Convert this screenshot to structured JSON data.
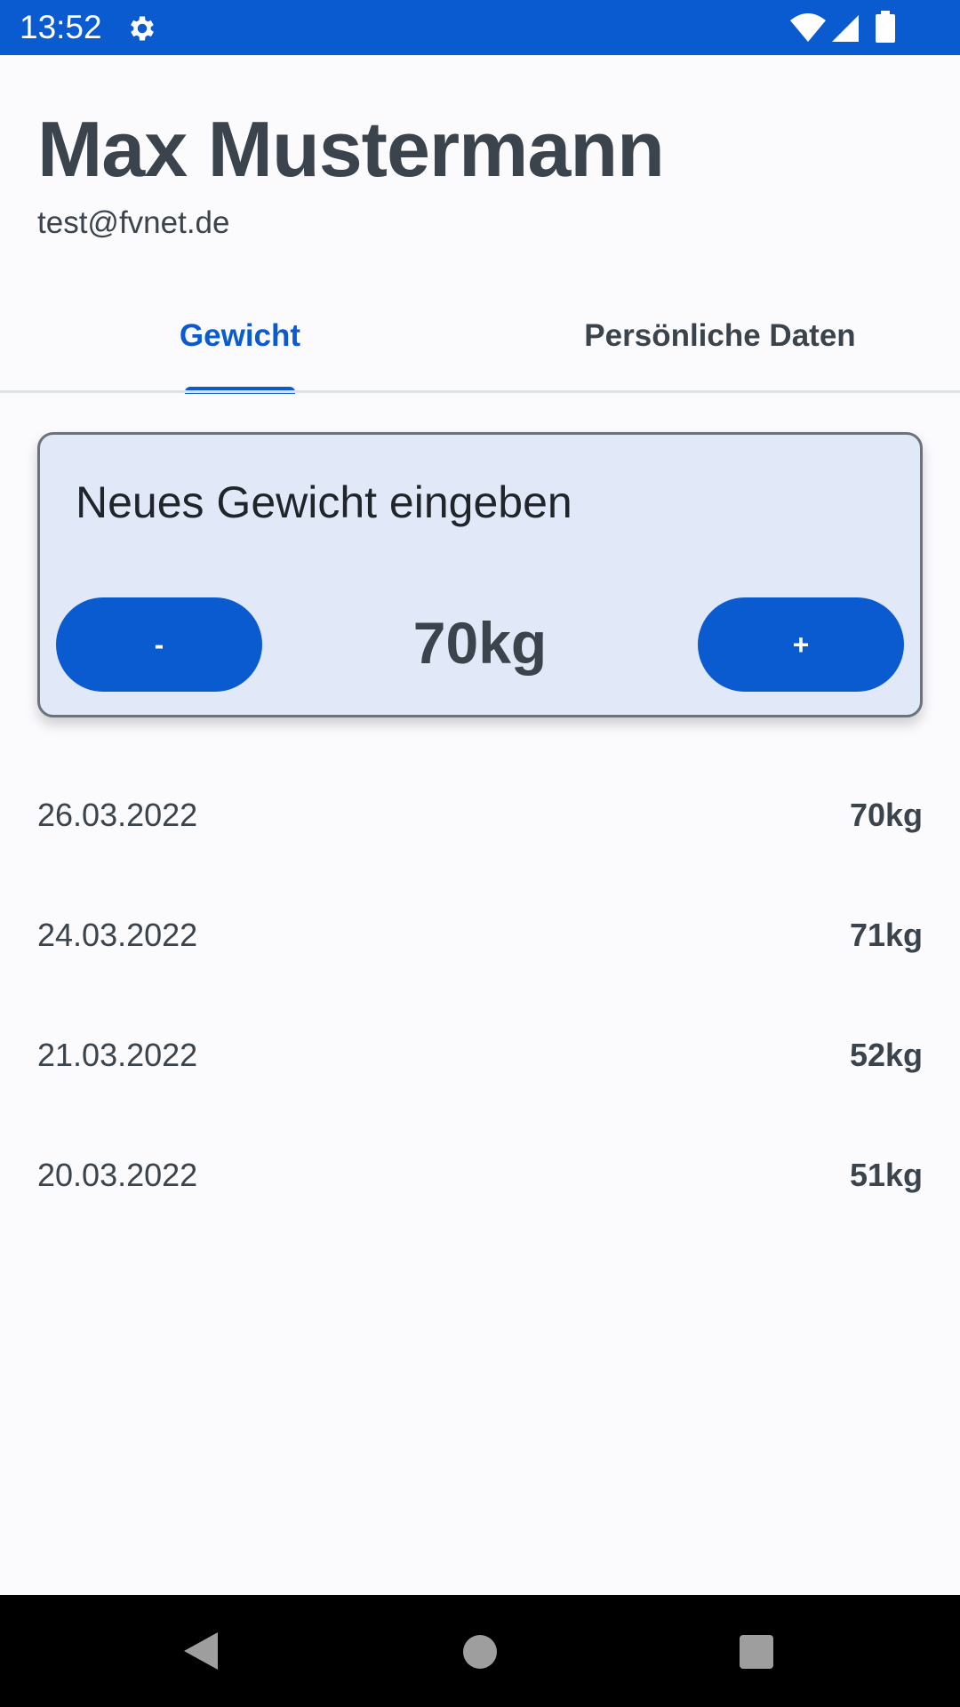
{
  "status_bar": {
    "time": "13:52",
    "icons": [
      "gear-icon",
      "wifi-icon",
      "signal-icon",
      "battery-icon"
    ],
    "color": "#0b5bd0"
  },
  "profile": {
    "name": "Max Mustermann",
    "email": "test@fvnet.de"
  },
  "tabs": [
    {
      "label": "Gewicht",
      "active": true
    },
    {
      "label": "Persönliche Daten",
      "active": false
    }
  ],
  "weight_card": {
    "title": "Neues Gewicht eingeben",
    "minus_label": "-",
    "plus_label": "+",
    "value": "70kg"
  },
  "entries": [
    {
      "date": "26.03.2022",
      "weight": "70kg"
    },
    {
      "date": "24.03.2022",
      "weight": "71kg"
    },
    {
      "date": "21.03.2022",
      "weight": "52kg"
    },
    {
      "date": "20.03.2022",
      "weight": "51kg"
    }
  ],
  "nav_bar": {
    "icons": [
      "back-icon",
      "home-icon",
      "recents-icon"
    ]
  },
  "colors": {
    "accent": "#0b5bd0",
    "text": "#3b434c",
    "card_background": "#e1e9f8",
    "page_background": "#fbfbfd"
  }
}
